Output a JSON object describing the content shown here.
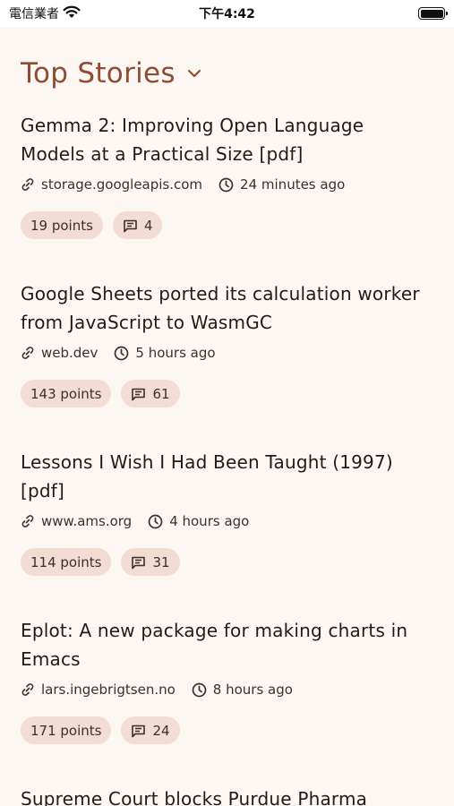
{
  "status_bar": {
    "carrier": "電信業者",
    "time": "下午4:42"
  },
  "header": {
    "title": "Top Stories"
  },
  "stories": [
    {
      "title": "Gemma 2: Improving Open Language Models at a Practical Size [pdf]",
      "domain": "storage.googleapis.com",
      "age": "24 minutes ago",
      "points": "19 points",
      "comments": "4"
    },
    {
      "title": "Google Sheets ported its calculation worker from JavaScript to WasmGC",
      "domain": "web.dev",
      "age": "5 hours ago",
      "points": "143 points",
      "comments": "61"
    },
    {
      "title": "Lessons I Wish I Had Been Taught (1997) [pdf]",
      "domain": "www.ams.org",
      "age": "4 hours ago",
      "points": "114 points",
      "comments": "31"
    },
    {
      "title": "Eplot: A new package for making charts in Emacs",
      "domain": "lars.ingebrigtsen.no",
      "age": "8 hours ago",
      "points": "171 points",
      "comments": "24"
    },
    {
      "title": "Supreme Court blocks Purdue Pharma",
      "domain": "",
      "age": "",
      "points": "",
      "comments": ""
    }
  ],
  "icons": {
    "link": "link-icon",
    "clock": "clock-icon",
    "comment": "comment-icon",
    "chevron": "chevron-down-icon"
  },
  "colors": {
    "accent": "#8f4c33",
    "chip": "#f3dcd3",
    "background": "#fdf7f4"
  }
}
